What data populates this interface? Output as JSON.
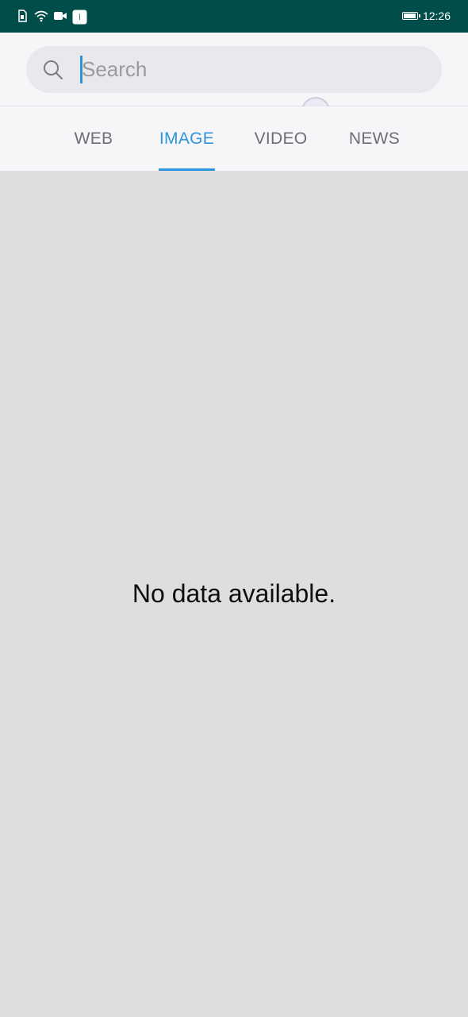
{
  "status_bar": {
    "time": "12:26",
    "battery_level": 1.0,
    "left_icons": [
      "sim-card-icon",
      "wifi-icon",
      "video-camera-icon",
      "app-notification-icon"
    ]
  },
  "search": {
    "placeholder": "Search",
    "value": ""
  },
  "tabs": [
    {
      "label": "WEB",
      "active": false
    },
    {
      "label": "IMAGE",
      "active": true
    },
    {
      "label": "VIDEO",
      "active": false
    },
    {
      "label": "NEWS",
      "active": false
    }
  ],
  "content": {
    "empty_message": "No data available."
  },
  "colors": {
    "status_bar_bg": "#004d4a",
    "accent": "#2f95dc",
    "content_bg": "#dfdde0"
  }
}
